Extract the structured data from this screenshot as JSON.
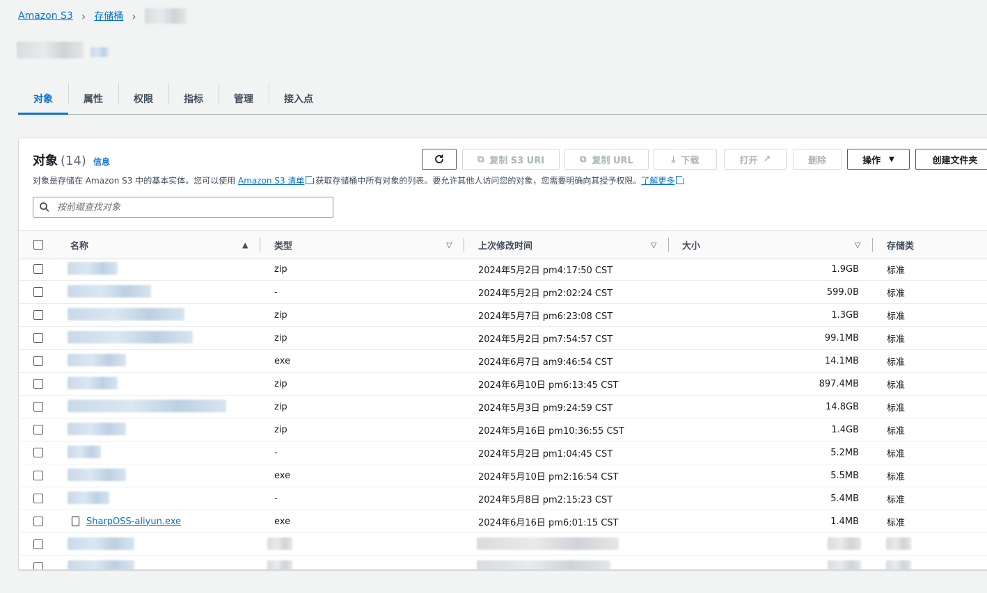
{
  "breadcrumb": {
    "root": "Amazon S3",
    "buckets": "存储桶"
  },
  "tabs": [
    "对象",
    "属性",
    "权限",
    "指标",
    "管理",
    "接入点"
  ],
  "panel": {
    "title": "对象",
    "count": "(14)",
    "info": "信息",
    "desc_prefix": "对象是存储在 Amazon S3 中的基本实体。您可以使用 ",
    "desc_link1": "Amazon S3 清单",
    "desc_middle": "获取存储桶中所有对象的列表。要允许其他人访问您的对象，您需要明确向其授予权限。",
    "desc_link2": "了解更多"
  },
  "toolbar": {
    "copy_s3_uri": "复制 S3 URI",
    "copy_url": "复制 URL",
    "download": "下载",
    "open": "打开",
    "delete": "删除",
    "actions": "操作",
    "create_folder": "创建文件夹"
  },
  "search": {
    "placeholder": "按前缀查找对象"
  },
  "columns": {
    "name": "名称",
    "type": "类型",
    "modified": "上次修改时间",
    "size": "大小",
    "storage_class": "存储类"
  },
  "rows": [
    {
      "type": "zip",
      "modified": "2024年5月2日 pm4:17:50 CST",
      "size": "1.9GB",
      "class": "标准"
    },
    {
      "type": "-",
      "modified": "2024年5月2日 pm2:02:24 CST",
      "size": "599.0B",
      "class": "标准"
    },
    {
      "type": "zip",
      "modified": "2024年5月7日 pm6:23:08 CST",
      "size": "1.3GB",
      "class": "标准"
    },
    {
      "type": "zip",
      "modified": "2024年5月2日 pm7:54:57 CST",
      "size": "99.1MB",
      "class": "标准"
    },
    {
      "type": "exe",
      "modified": "2024年6月7日 am9:46:54 CST",
      "size": "14.1MB",
      "class": "标准"
    },
    {
      "type": "zip",
      "modified": "2024年6月10日 pm6:13:45 CST",
      "size": "897.4MB",
      "class": "标准"
    },
    {
      "type": "zip",
      "modified": "2024年5月3日 pm9:24:59 CST",
      "size": "14.8GB",
      "class": "标准"
    },
    {
      "type": "zip",
      "modified": "2024年5月16日 pm10:36:55 CST",
      "size": "1.4GB",
      "class": "标准"
    },
    {
      "type": "-",
      "modified": "2024年5月2日 pm1:04:45 CST",
      "size": "5.2MB",
      "class": "标准"
    },
    {
      "type": "exe",
      "modified": "2024年5月10日 pm2:16:54 CST",
      "size": "5.5MB",
      "class": "标准"
    },
    {
      "type": "-",
      "modified": "2024年5月8日 pm2:15:23 CST",
      "size": "5.4MB",
      "class": "标准"
    },
    {
      "name": "SharpOSS-aliyun.exe",
      "type": "exe",
      "modified": "2024年6月16日 pm6:01:15 CST",
      "size": "1.4MB",
      "class": "标准"
    }
  ]
}
